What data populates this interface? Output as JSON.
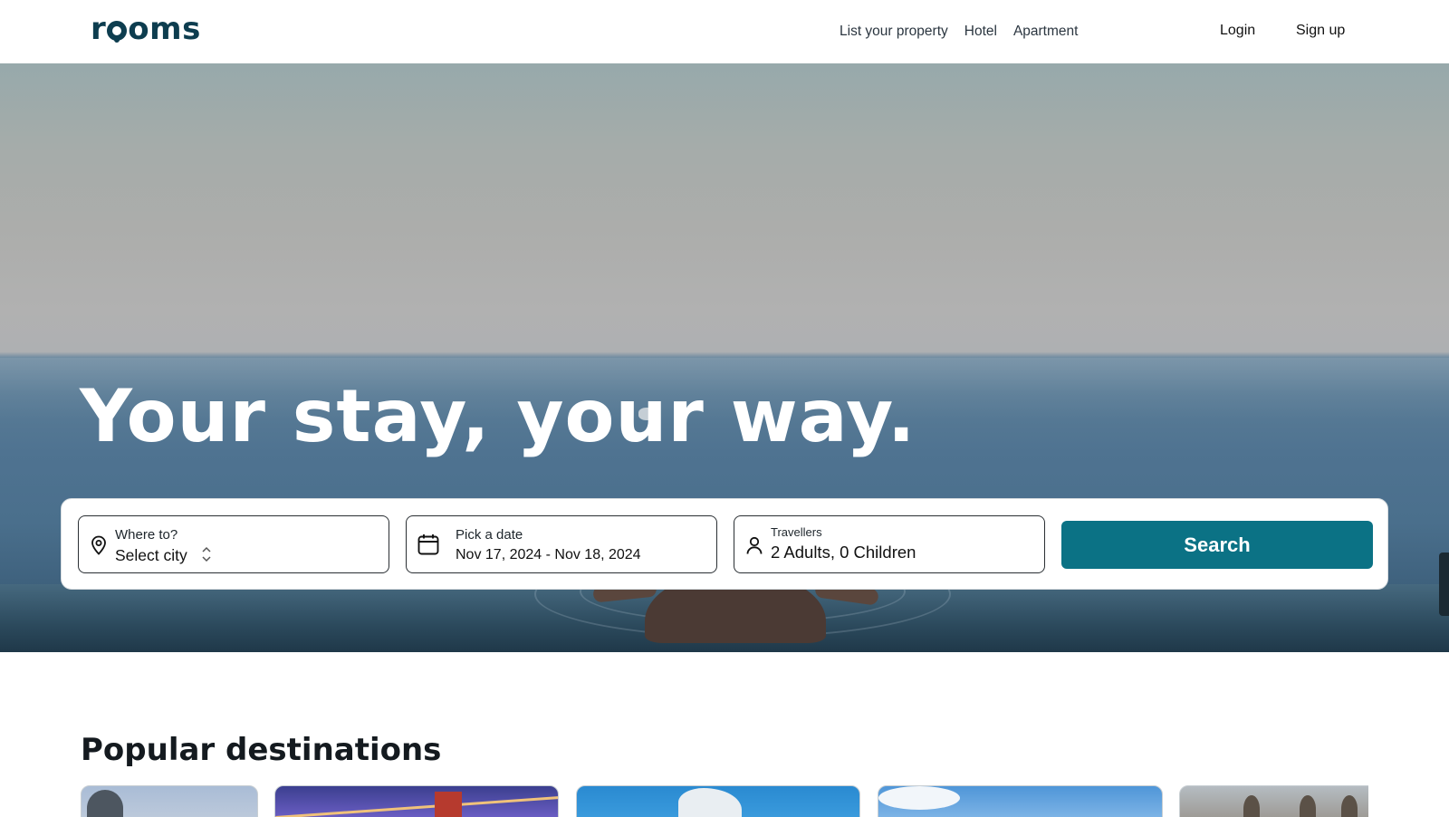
{
  "header": {
    "logo_text_pre": "r",
    "logo_text_post": "oms",
    "nav": [
      "List your property",
      "Hotel",
      "Apartment"
    ],
    "login": "Login",
    "signup": "Sign up"
  },
  "hero": {
    "headline": "Your stay, your way."
  },
  "search": {
    "where": {
      "label": "Where to?",
      "value": "Select city"
    },
    "date": {
      "label": "Pick a date",
      "value": "Nov 17, 2024 - Nov 18, 2024"
    },
    "travellers": {
      "label": "Travellers",
      "value": "2 Adults, 0 Children"
    },
    "button": "Search",
    "icons": {
      "where": "location-pin-icon",
      "date": "calendar-icon",
      "travellers": "person-icon",
      "select": "chevron-updown-icon"
    }
  },
  "destinations": {
    "title": "Popular destinations"
  },
  "colors": {
    "brand": "#0d3d4f",
    "accent": "#0b7285"
  }
}
